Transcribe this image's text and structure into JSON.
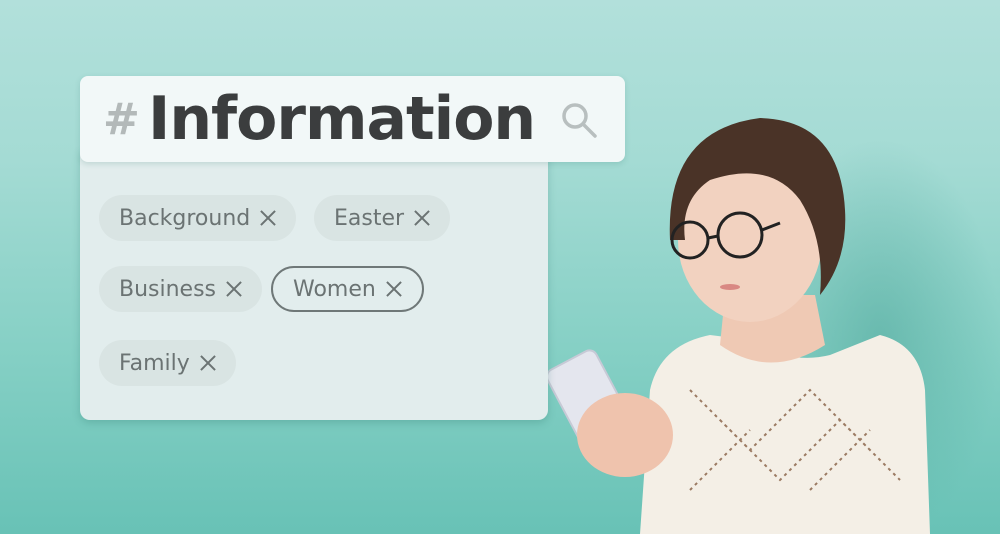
{
  "search": {
    "hash_symbol": "#",
    "query": "Information",
    "icon": "search-icon"
  },
  "tags": [
    {
      "label": "Background",
      "selected": false,
      "remove_icon": "close-icon"
    },
    {
      "label": "Easter",
      "selected": false,
      "remove_icon": "close-icon"
    },
    {
      "label": "Business",
      "selected": false,
      "remove_icon": "close-icon"
    },
    {
      "label": "Women",
      "selected": true,
      "remove_icon": "close-icon"
    },
    {
      "label": "Family",
      "selected": false,
      "remove_icon": "close-icon"
    }
  ],
  "photo": {
    "subject": "woman with glasses using smartphone",
    "background_color": "#86d0c5"
  },
  "colors": {
    "query_text": "#3b3d3e",
    "tag_text": "#6b7373",
    "tag_bg": "#d9e4e3",
    "panel_bg": "#e2eded",
    "header_bg": "#f2f8f8"
  }
}
